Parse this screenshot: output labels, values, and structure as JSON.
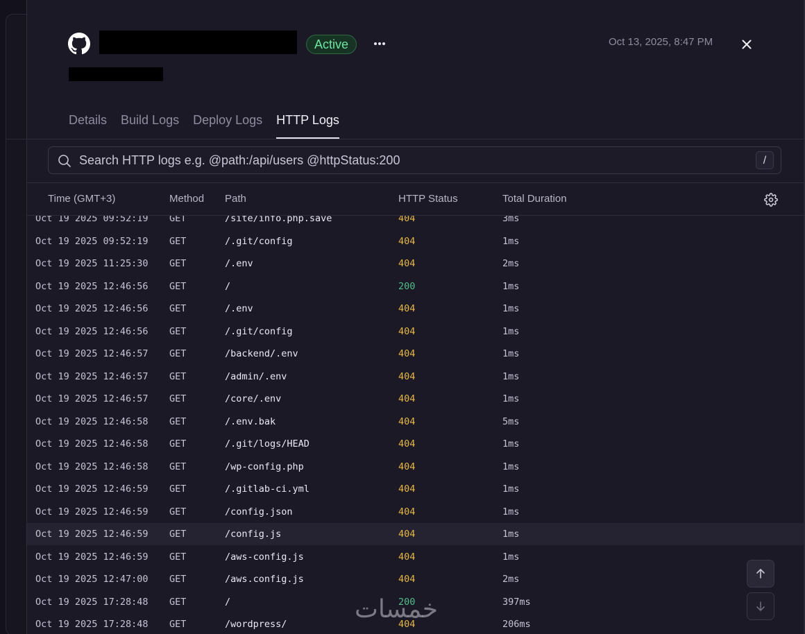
{
  "header": {
    "status": "Active",
    "timestamp": "Oct 13, 2025, 8:47 PM"
  },
  "icons": {
    "repo": "github-icon",
    "more": "more-horizontal-icon",
    "close": "close-icon",
    "search": "search-icon",
    "settings": "gear-icon",
    "scroll_up": "arrow-up-icon",
    "scroll_down": "arrow-down-icon"
  },
  "tabs": [
    {
      "label": "Details",
      "active": false
    },
    {
      "label": "Build Logs",
      "active": false
    },
    {
      "label": "Deploy Logs",
      "active": false
    },
    {
      "label": "HTTP Logs",
      "active": true
    }
  ],
  "search": {
    "placeholder": "Search HTTP logs e.g. @path:/api/users @httpStatus:200",
    "value": "",
    "shortcut": "/"
  },
  "table": {
    "columns": [
      "Time (GMT+3)",
      "Method",
      "Path",
      "HTTP Status",
      "Total Duration"
    ],
    "rows": [
      {
        "time": "Oct 19 2025 09:52:19",
        "method": "GET",
        "path": "/site/info.php.save",
        "status": "404",
        "duration": "3ms"
      },
      {
        "time": "Oct 19 2025 09:52:19",
        "method": "GET",
        "path": "/.git/config",
        "status": "404",
        "duration": "1ms"
      },
      {
        "time": "Oct 19 2025 11:25:30",
        "method": "GET",
        "path": "/.env",
        "status": "404",
        "duration": "2ms"
      },
      {
        "time": "Oct 19 2025 12:46:56",
        "method": "GET",
        "path": "/",
        "status": "200",
        "duration": "1ms"
      },
      {
        "time": "Oct 19 2025 12:46:56",
        "method": "GET",
        "path": "/.env",
        "status": "404",
        "duration": "1ms"
      },
      {
        "time": "Oct 19 2025 12:46:56",
        "method": "GET",
        "path": "/.git/config",
        "status": "404",
        "duration": "1ms"
      },
      {
        "time": "Oct 19 2025 12:46:57",
        "method": "GET",
        "path": "/backend/.env",
        "status": "404",
        "duration": "1ms"
      },
      {
        "time": "Oct 19 2025 12:46:57",
        "method": "GET",
        "path": "/admin/.env",
        "status": "404",
        "duration": "1ms"
      },
      {
        "time": "Oct 19 2025 12:46:57",
        "method": "GET",
        "path": "/core/.env",
        "status": "404",
        "duration": "1ms"
      },
      {
        "time": "Oct 19 2025 12:46:58",
        "method": "GET",
        "path": "/.env.bak",
        "status": "404",
        "duration": "5ms"
      },
      {
        "time": "Oct 19 2025 12:46:58",
        "method": "GET",
        "path": "/.git/logs/HEAD",
        "status": "404",
        "duration": "1ms"
      },
      {
        "time": "Oct 19 2025 12:46:58",
        "method": "GET",
        "path": "/wp-config.php",
        "status": "404",
        "duration": "1ms"
      },
      {
        "time": "Oct 19 2025 12:46:59",
        "method": "GET",
        "path": "/.gitlab-ci.yml",
        "status": "404",
        "duration": "1ms"
      },
      {
        "time": "Oct 19 2025 12:46:59",
        "method": "GET",
        "path": "/config.json",
        "status": "404",
        "duration": "1ms"
      },
      {
        "time": "Oct 19 2025 12:46:59",
        "method": "GET",
        "path": "/config.js",
        "status": "404",
        "duration": "1ms",
        "highlighted": true
      },
      {
        "time": "Oct 19 2025 12:46:59",
        "method": "GET",
        "path": "/aws-config.js",
        "status": "404",
        "duration": "1ms"
      },
      {
        "time": "Oct 19 2025 12:47:00",
        "method": "GET",
        "path": "/aws.config.js",
        "status": "404",
        "duration": "2ms"
      },
      {
        "time": "Oct 19 2025 17:28:48",
        "method": "GET",
        "path": "/",
        "status": "200",
        "duration": "397ms"
      },
      {
        "time": "Oct 19 2025 17:28:48",
        "method": "GET",
        "path": "/wordpress/",
        "status": "404",
        "duration": "206ms"
      }
    ]
  },
  "colors": {
    "status_404": "#e8b93e",
    "status_200": "#4fbf8a",
    "active_badge": "#6ee6a1",
    "background": "#1b1926"
  },
  "watermark": "خمسات"
}
